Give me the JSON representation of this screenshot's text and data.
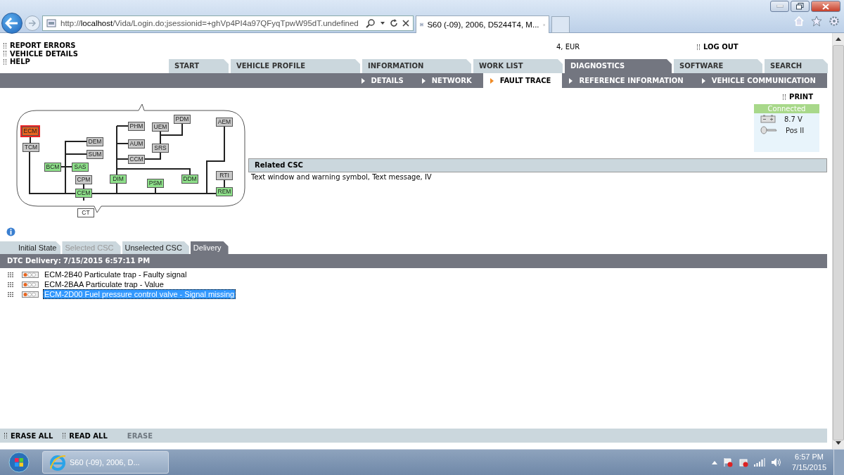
{
  "browser": {
    "address": "http://**localhost**/Vida/Login.do;jsessionid=+ghVp4PI4a97QFyqTpwW95dT.undefined",
    "tab_title": "S60 (-09), 2006, D5244T4, M..."
  },
  "top_links": [
    "REPORT ERRORS",
    "VEHICLE DETAILS",
    "HELP"
  ],
  "account": "4, EUR",
  "logout": "LOG OUT",
  "tabs": [
    {
      "label": "START",
      "selected": false
    },
    {
      "label": "VEHICLE PROFILE",
      "selected": false
    },
    {
      "label": "INFORMATION",
      "selected": false
    },
    {
      "label": "WORK LIST",
      "selected": false
    },
    {
      "label": "DIAGNOSTICS",
      "selected": true
    },
    {
      "label": "SOFTWARE",
      "selected": false
    },
    {
      "label": "SEARCH",
      "selected": false
    }
  ],
  "subtabs": [
    {
      "label": "DETAILS",
      "selected": false
    },
    {
      "label": "NETWORK",
      "selected": false
    },
    {
      "label": "FAULT TRACE",
      "selected": true
    },
    {
      "label": "REFERENCE INFORMATION",
      "selected": false
    },
    {
      "label": "VEHICLE COMMUNICATION",
      "selected": false
    }
  ],
  "network": {
    "nodes": [
      {
        "label": "ECM",
        "color": "#e8641e"
      },
      {
        "label": "TCM",
        "color": "#c8c8c8"
      },
      {
        "label": "DEM",
        "color": "#c8c8c8"
      },
      {
        "label": "SUM",
        "color": "#c8c8c8"
      },
      {
        "label": "BCM",
        "color": "#8ee08a"
      },
      {
        "label": "SAS",
        "color": "#8ee08a"
      },
      {
        "label": "CPM",
        "color": "#c8c8c8"
      },
      {
        "label": "CEM",
        "color": "#8ee08a"
      },
      {
        "label": "CT",
        "color": "#ffffff"
      },
      {
        "label": "PHM",
        "color": "#c8c8c8"
      },
      {
        "label": "AUM",
        "color": "#c8c8c8"
      },
      {
        "label": "CCM",
        "color": "#c8c8c8"
      },
      {
        "label": "DIM",
        "color": "#8ee08a"
      },
      {
        "label": "UEM",
        "color": "#c8c8c8"
      },
      {
        "label": "SRS",
        "color": "#c8c8c8"
      },
      {
        "label": "PDM",
        "color": "#c8c8c8"
      },
      {
        "label": "PSM",
        "color": "#8ee08a"
      },
      {
        "label": "DDM",
        "color": "#8ee08a"
      },
      {
        "label": "AEM",
        "color": "#c8c8c8"
      },
      {
        "label": "RTI",
        "color": "#c8c8c8"
      },
      {
        "label": "REM",
        "color": "#8ee08a"
      }
    ]
  },
  "print": "PRINT",
  "connection": {
    "status": "Connected",
    "voltage": "8.7 V",
    "key_position": "Pos II"
  },
  "related_csc": {
    "title": "Related CSC",
    "text": "Text window and warning symbol, Text message, IV"
  },
  "result_tabs": [
    {
      "label": "Initial State",
      "selected": false,
      "disabled": false
    },
    {
      "label": "Selected CSC",
      "selected": false,
      "disabled": true
    },
    {
      "label": "Unselected CSC",
      "selected": false,
      "disabled": false
    },
    {
      "label": "Delivery",
      "selected": true,
      "disabled": false
    }
  ],
  "dtc": {
    "title": "DTC Delivery: 7/15/2015 6:57:11 PM",
    "rows": [
      {
        "text": "ECM-2B40 Particulate trap - Faulty signal",
        "selected": false
      },
      {
        "text": "ECM-2BAA Particulate trap - Value",
        "selected": false
      },
      {
        "text": "ECM-2D00 Fuel pressure control valve - Signal missing",
        "selected": true
      }
    ]
  },
  "actions": [
    {
      "label": "ERASE ALL",
      "disabled": false
    },
    {
      "label": "READ ALL",
      "disabled": false
    },
    {
      "label": "ERASE",
      "disabled": true
    }
  ],
  "taskbar": {
    "task": "S60 (-09), 2006, D...",
    "time": "6:57 PM",
    "date": "7/15/2015"
  }
}
